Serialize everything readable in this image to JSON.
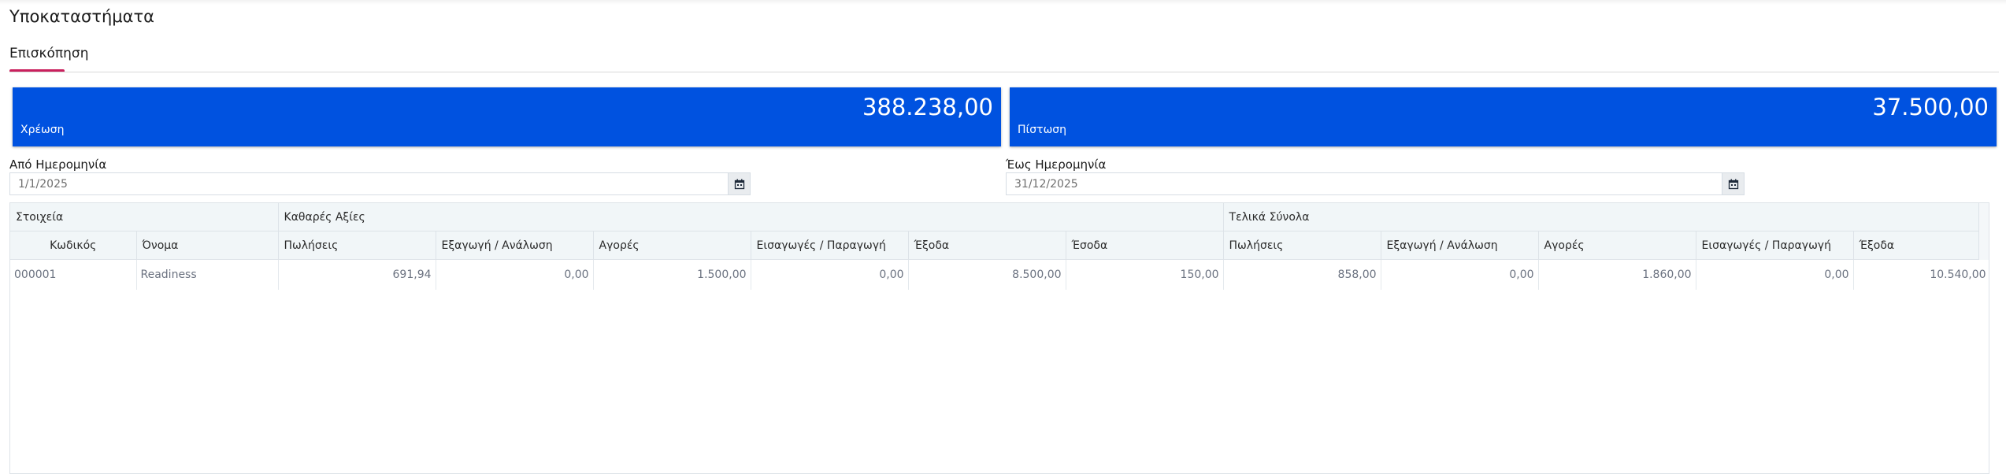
{
  "header": {
    "title": "Υποκαταστήματα"
  },
  "tabs": [
    {
      "label": "Επισκόπηση",
      "active": true
    }
  ],
  "colors": {
    "accent": "#c9205d",
    "card": "#0052e0"
  },
  "cards": {
    "debit": {
      "amount": "388.238,00",
      "label": "Χρέωση"
    },
    "credit": {
      "amount": "37.500,00",
      "label": "Πίστωση"
    }
  },
  "filters": {
    "from": {
      "label": "Από Ημερομηνία",
      "value": "1/1/2025",
      "icon": "calendar-icon"
    },
    "to": {
      "label": "Έως Ημερομηνία",
      "value": "31/12/2025",
      "icon": "calendar-icon"
    }
  },
  "table": {
    "groups": [
      "Στοιχεία",
      "Καθαρές Αξίες",
      "Τελικά Σύνολα"
    ],
    "columns": [
      "Κωδικός",
      "Όνομα",
      "Πωλήσεις",
      "Εξαγωγή / Ανάλωση",
      "Αγορές",
      "Εισαγωγές / Παραγωγή",
      "Έξοδα",
      "Έσοδα",
      "Πωλήσεις",
      "Εξαγωγή / Ανάλωση",
      "Αγορές",
      "Εισαγωγές / Παραγωγή",
      "Έξοδα"
    ],
    "rows": [
      [
        "000001",
        "Readiness",
        "691,94",
        "0,00",
        "1.500,00",
        "0,00",
        "8.500,00",
        "150,00",
        "858,00",
        "0,00",
        "1.860,00",
        "0,00",
        "10.540,00"
      ]
    ]
  }
}
